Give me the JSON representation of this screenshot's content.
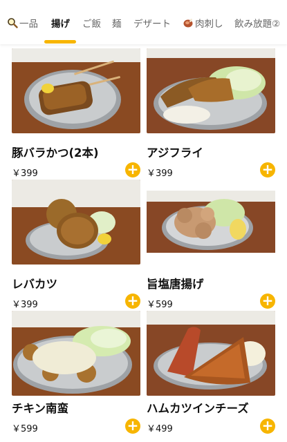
{
  "tabs": [
    {
      "label": "一品",
      "icon": "magnifier-icon"
    },
    {
      "label": "揚げ"
    },
    {
      "label": "ご飯"
    },
    {
      "label": "麺"
    },
    {
      "label": "デザート"
    },
    {
      "label": "肉刺し",
      "icon": "meat-icon"
    },
    {
      "label": "飲み放題②"
    }
  ],
  "active_tab": "揚げ",
  "accent_color": "#f7b500",
  "items": [
    {
      "name": "豚バラかつ(2本)",
      "price": "￥399"
    },
    {
      "name": "アジフライ",
      "price": "￥399"
    },
    {
      "name": "レバカツ",
      "price": "￥399"
    },
    {
      "name": "旨塩唐揚げ",
      "price": "￥599"
    },
    {
      "name": "チキン南蛮",
      "price": "￥599"
    },
    {
      "name": "ハムカツインチーズ",
      "price": "￥499"
    }
  ],
  "add_label": "+"
}
